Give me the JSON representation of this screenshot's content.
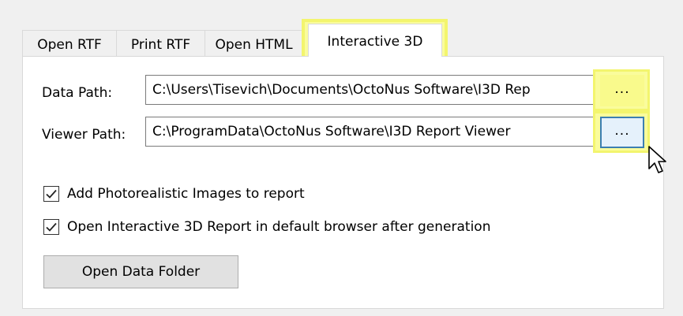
{
  "tabs": [
    {
      "label": "Open RTF"
    },
    {
      "label": "Print RTF"
    },
    {
      "label": "Open HTML"
    },
    {
      "label": "Interactive 3D",
      "active": true
    }
  ],
  "data_path": {
    "label": "Data Path:",
    "value": "C:\\Users\\Tisevich\\Documents\\OctoNus Software\\I3D Rep",
    "browse_label": "..."
  },
  "viewer_path": {
    "label": "Viewer Path:",
    "value": "C:\\ProgramData\\OctoNus Software\\I3D Report Viewer",
    "browse_label": "..."
  },
  "options": [
    {
      "label": "Add Photorealistic Images to report",
      "checked": true
    },
    {
      "label": "Open Interactive 3D Report in default browser after generation",
      "checked": true
    }
  ],
  "open_folder_button": "Open Data Folder",
  "colors": {
    "highlight": "#fafc9c",
    "focus_border": "#3c7fb1"
  },
  "icons": {
    "checkbox": "checkmark-icon",
    "cursor": "mouse-pointer-icon"
  }
}
